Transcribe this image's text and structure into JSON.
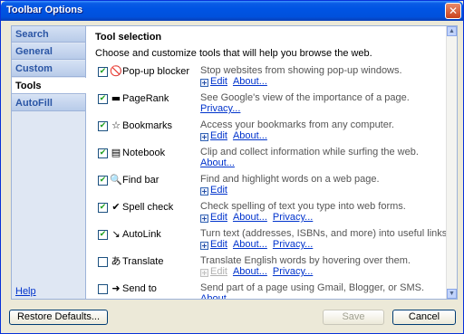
{
  "window": {
    "title": "Toolbar Options",
    "close_glyph": "✕"
  },
  "sidebar": {
    "tabs": [
      {
        "label": "Search"
      },
      {
        "label": "General"
      },
      {
        "label": "Custom Buttons"
      },
      {
        "label": "Tools"
      },
      {
        "label": "AutoFill"
      }
    ],
    "active_tab": "Tools",
    "help_label": "Help"
  },
  "content": {
    "title": "Tool selection",
    "description": "Choose and customize tools that will help you browse the web.",
    "tools": [
      {
        "name": "Pop-up blocker",
        "icon": "popup-blocker-icon",
        "glyph": "🚫",
        "checked": true,
        "desc": "Stop websites from showing pop-up windows.",
        "links": [
          "Edit",
          "About..."
        ]
      },
      {
        "name": "PageRank",
        "icon": "pagerank-icon",
        "glyph": "▬",
        "checked": true,
        "desc": "See Google's view of the importance of a page.",
        "links": [
          "Privacy..."
        ]
      },
      {
        "name": "Bookmarks",
        "icon": "bookmarks-icon",
        "glyph": "☆",
        "checked": true,
        "desc": "Access your bookmarks from any computer.",
        "links": [
          "Edit",
          "About..."
        ]
      },
      {
        "name": "Notebook",
        "icon": "notebook-icon",
        "glyph": "▤",
        "checked": true,
        "desc": "Clip and collect information while surfing the web.",
        "links": [
          "About..."
        ]
      },
      {
        "name": "Find bar",
        "icon": "find-bar-icon",
        "glyph": "🔍",
        "checked": true,
        "desc": "Find and highlight words on a web page.",
        "links": [
          "Edit"
        ]
      },
      {
        "name": "Spell check",
        "icon": "spell-check-icon",
        "glyph": "✔",
        "checked": true,
        "desc": "Check spelling of text you type into web forms.",
        "links": [
          "Edit",
          "About...",
          "Privacy..."
        ]
      },
      {
        "name": "AutoLink",
        "icon": "autolink-icon",
        "glyph": "↘",
        "checked": true,
        "desc": "Turn text (addresses, ISBNs, and more) into useful links.",
        "links": [
          "Edit",
          "About...",
          "Privacy..."
        ]
      },
      {
        "name": "Translate",
        "icon": "translate-icon",
        "glyph": "あ",
        "checked": false,
        "desc": "Translate English words by hovering over them.",
        "links": [
          "Edit",
          "About...",
          "Privacy..."
        ],
        "edit_disabled": true
      },
      {
        "name": "Send to",
        "icon": "send-to-icon",
        "glyph": "➜",
        "checked": false,
        "desc": "Send part of a page using Gmail, Blogger, or SMS.",
        "links": [
          "About..."
        ]
      }
    ]
  },
  "footer": {
    "restore_label": "Restore Defaults...",
    "save_label": "Save",
    "cancel_label": "Cancel"
  },
  "colors": {
    "titlebar": "#0054e3",
    "link": "#0033cc",
    "check": "#21a121",
    "frame": "#ece9d8"
  }
}
